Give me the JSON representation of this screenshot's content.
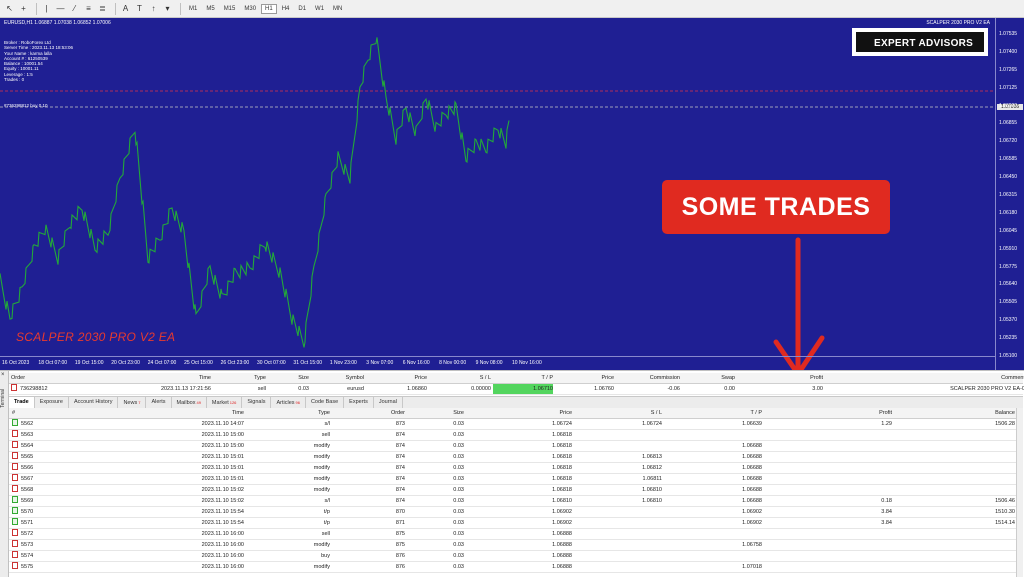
{
  "toolbar": {
    "timeframes": [
      "M1",
      "M5",
      "M15",
      "M30",
      "H1",
      "H4",
      "D1",
      "W1",
      "MN"
    ],
    "active_timeframe": "H1"
  },
  "chart": {
    "symbol_header": "EURUSD,H1  1.06887 1.07038 1.06852 1.07006",
    "ea_title": "SCALPER 2030 PRO V2 EA",
    "info_lines": [
      "Broker   : RoboForex Ltd",
      "Server Time : 2023.11.13 18:53:06",
      "Your Name    : karma lalla",
      "Account #  : 61250539",
      "Balance  : 10001.54",
      "Equity   : 10001.11",
      "Leverage  : 1:5",
      "Trades : 0"
    ],
    "order_tag": "#736298812 buy 0.10",
    "ea_label": "SCALPER 2030 PRO V2 EA",
    "logo_text": "EXPERT ADVISORS",
    "callout": "SOME TRADES",
    "current_price": "1.07006",
    "price_ticks": [
      "1.07535",
      "1.07400",
      "1.07265",
      "1.07125",
      "1.06990",
      "1.06855",
      "1.06720",
      "1.06585",
      "1.06450",
      "1.06315",
      "1.06180",
      "1.06045",
      "1.05910",
      "1.05775",
      "1.05640",
      "1.05505",
      "1.05370",
      "1.05235",
      "1.05100"
    ],
    "time_ticks": [
      "16 Oct 2023",
      "18 Oct 07:00",
      "19 Oct 15:00",
      "20 Oct 23:00",
      "24 Oct 07:00",
      "25 Oct 15:00",
      "26 Oct 23:00",
      "30 Oct 07:00",
      "31 Oct 15:00",
      "1 Nov 23:00",
      "3 Nov 07:00",
      "6 Nov 16:00",
      "8 Nov 00:00",
      "9 Nov 08:00",
      "10 Nov 16:00"
    ],
    "colors": {
      "background": "#1f1f93",
      "line": "#22a83a",
      "level_red": "#e0344a",
      "level_gray": "#c8c8c8"
    }
  },
  "open_trades": {
    "headers": [
      "Order",
      "Time",
      "Type",
      "Size",
      "Symbol",
      "Price",
      "S / L",
      "T / P",
      "Price",
      "Commission",
      "Swap",
      "Profit",
      "Comment"
    ],
    "rows": [
      [
        "736298812",
        "2023.11.13 17:21:56",
        "sell",
        "0.03",
        "eurusd",
        "1.06860",
        "0.00000",
        "1.06710",
        "1.06760",
        "-0.06",
        "0.00",
        "3.00",
        "SCALPER 2030 PRO V2 EA-0"
      ]
    ]
  },
  "tabs": [
    {
      "label": "Trade",
      "active": true,
      "badge": ""
    },
    {
      "label": "Exposure",
      "active": false,
      "badge": ""
    },
    {
      "label": "Account History",
      "active": false,
      "badge": ""
    },
    {
      "label": "News",
      "active": false,
      "badge": "7"
    },
    {
      "label": "Alerts",
      "active": false,
      "badge": ""
    },
    {
      "label": "Mailbox",
      "active": false,
      "badge": "49"
    },
    {
      "label": "Market",
      "active": false,
      "badge": "126"
    },
    {
      "label": "Signals",
      "active": false,
      "badge": ""
    },
    {
      "label": "Articles",
      "active": false,
      "badge": "96"
    },
    {
      "label": "Code Base",
      "active": false,
      "badge": ""
    },
    {
      "label": "Experts",
      "active": false,
      "badge": ""
    },
    {
      "label": "Journal",
      "active": false,
      "badge": ""
    }
  ],
  "terminal_label": "Terminal",
  "history": {
    "headers": [
      "#",
      "Time",
      "Type",
      "Order",
      "Size",
      "Price",
      "S / L",
      "T / P",
      "Profit",
      "Balance"
    ],
    "rows": [
      [
        "5562",
        "2023.11.10 14:07",
        "s/l",
        "873",
        "0.03",
        "1.06724",
        "1.06724",
        "1.06639",
        "1.29",
        "1506.28"
      ],
      [
        "5563",
        "2023.11.10 15:00",
        "sell",
        "874",
        "0.03",
        "1.06818",
        "",
        "",
        "",
        ""
      ],
      [
        "5564",
        "2023.11.10 15:00",
        "modify",
        "874",
        "0.03",
        "1.06818",
        "",
        "1.06688",
        "",
        ""
      ],
      [
        "5565",
        "2023.11.10 15:01",
        "modify",
        "874",
        "0.03",
        "1.06818",
        "1.06813",
        "1.06688",
        "",
        ""
      ],
      [
        "5566",
        "2023.11.10 15:01",
        "modify",
        "874",
        "0.03",
        "1.06818",
        "1.06812",
        "1.06688",
        "",
        ""
      ],
      [
        "5567",
        "2023.11.10 15:01",
        "modify",
        "874",
        "0.03",
        "1.06818",
        "1.06811",
        "1.06688",
        "",
        ""
      ],
      [
        "5568",
        "2023.11.10 15:02",
        "modify",
        "874",
        "0.03",
        "1.06818",
        "1.06810",
        "1.06688",
        "",
        ""
      ],
      [
        "5569",
        "2023.11.10 15:02",
        "s/l",
        "874",
        "0.03",
        "1.06810",
        "1.06810",
        "1.06688",
        "0.18",
        "1506.46"
      ],
      [
        "5570",
        "2023.11.10 15:54",
        "t/p",
        "870",
        "0.03",
        "1.06902",
        "",
        "1.06902",
        "3.84",
        "1510.30"
      ],
      [
        "5571",
        "2023.11.10 15:54",
        "t/p",
        "871",
        "0.03",
        "1.06902",
        "",
        "1.06902",
        "3.84",
        "1514.14"
      ],
      [
        "5572",
        "2023.11.10 16:00",
        "sell",
        "875",
        "0.03",
        "1.06888",
        "",
        "",
        "",
        ""
      ],
      [
        "5573",
        "2023.11.10 16:00",
        "modify",
        "875",
        "0.03",
        "1.06888",
        "",
        "1.06758",
        "",
        ""
      ],
      [
        "5574",
        "2023.11.10 16:00",
        "buy",
        "876",
        "0.03",
        "1.06888",
        "",
        "",
        "",
        ""
      ],
      [
        "5575",
        "2023.11.10 16:00",
        "modify",
        "876",
        "0.03",
        "1.06888",
        "",
        "1.07018",
        "",
        ""
      ]
    ]
  }
}
